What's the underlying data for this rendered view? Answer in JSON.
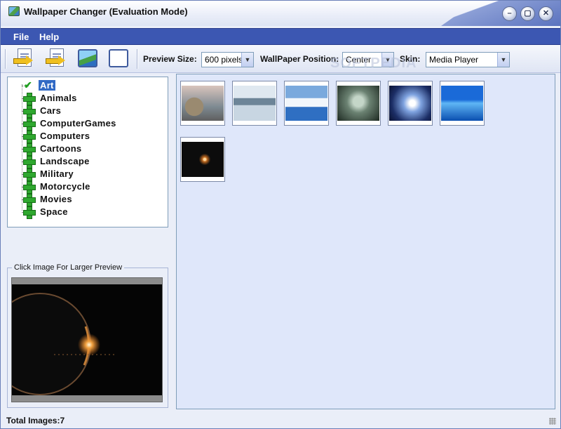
{
  "window": {
    "title": "Wallpaper Changer (Evaluation Mode)"
  },
  "title_buttons": {
    "minimize": "–",
    "maximize": "▢",
    "close": "✕"
  },
  "menu": {
    "items": [
      "File",
      "Help"
    ]
  },
  "toolbar": {
    "preview_size_label": "Preview Size:",
    "preview_size_value": "600 pixels",
    "position_label": "WallPaper Position:",
    "position_value": "Center",
    "skin_label": "Skin:",
    "skin_value": "Media Player",
    "icons": [
      "doc-arrow-icon",
      "doc-arrow-icon",
      "picture-icon",
      "blank-window-icon"
    ]
  },
  "watermark": "SOFTPEDIA",
  "tree": {
    "items": [
      {
        "label": "Art",
        "selected": true,
        "icon": "check-icon"
      },
      {
        "label": "Animals",
        "icon": "plus-icon"
      },
      {
        "label": "Cars",
        "icon": "plus-icon"
      },
      {
        "label": "ComputerGames",
        "icon": "plus-icon"
      },
      {
        "label": "Computers",
        "icon": "plus-icon"
      },
      {
        "label": "Cartoons",
        "icon": "plus-icon"
      },
      {
        "label": "Landscape",
        "icon": "plus-icon"
      },
      {
        "label": "Military",
        "icon": "plus-icon"
      },
      {
        "label": "Motorcycle",
        "icon": "plus-icon"
      },
      {
        "label": "Movies",
        "icon": "plus-icon"
      },
      {
        "label": "Space",
        "icon": "plus-icon"
      }
    ]
  },
  "preview": {
    "legend": "Click Image For Larger Preview"
  },
  "gallery": {
    "thumbnail_count": 7
  },
  "status": {
    "total_images": "Total Images:7"
  }
}
